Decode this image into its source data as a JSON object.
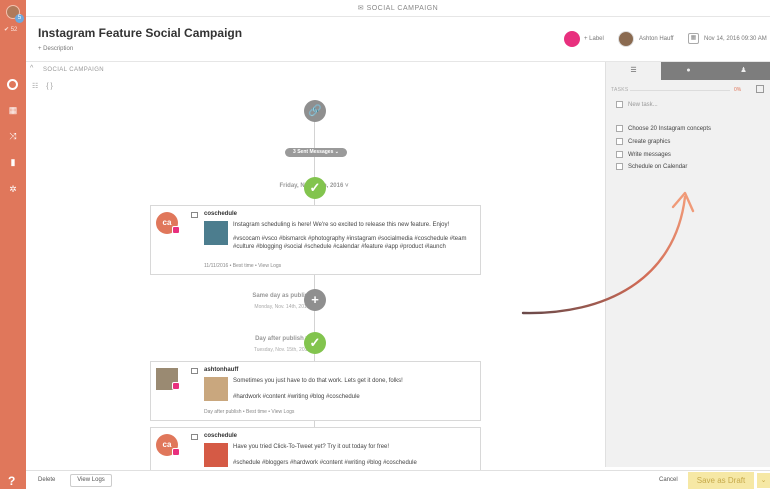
{
  "rail": {
    "badge": "5",
    "score": "✔ 52",
    "help": "?"
  },
  "topbar": {
    "label": "SOCIAL CAMPAIGN",
    "icon": "megaphone-icon"
  },
  "header": {
    "title": "Instagram Feature Social Campaign",
    "description": "+ Description",
    "label_action": "+ Label",
    "label_color": "#e8307e",
    "user_name": "Ashton Hauff",
    "datetime": "Nov 14, 2016 09:30 AM"
  },
  "subbar": {
    "label": "SOCIAL CAMPAIGN",
    "tool_grid": "☷",
    "tool_code": "{ }"
  },
  "timeline": {
    "sent_messages": "3 Sent Messages ⌄",
    "groups": [
      {
        "label": "Friday, Nov. 11th, 2016 ˅",
        "sub": ""
      },
      {
        "label": "Same day as publish",
        "sub": "Monday, Nov. 14th, 2016"
      },
      {
        "label": "Day after publish ˅",
        "sub": "Tuesday, Nov. 15th, 2016"
      }
    ],
    "cards": [
      {
        "account": "coschedule",
        "text1": "Instagram scheduling is here! We're so excited to release this new feature. Enjoy!",
        "text2": "#vscocam #vsco #bismarck #photography #instagram #socialmedia #coschedule #team #culture #blogging #social #schedule #calendar #feature #app #product #launch",
        "meta": "11/11/2016 • Best time • View Logs"
      },
      {
        "account": "ashtonhauff",
        "text1": "Sometimes you just have to do that work. Lets get it done, folks!",
        "text2": "#hardwork #content #writing #blog #coschedule",
        "meta": "Day after publish • Best time • View Logs"
      },
      {
        "account": "coschedule",
        "text1": "Have you tried Click-To-Tweet yet? Try it out today for free!",
        "text2": "#schedule #bloggers #hardwork #content #writing #blog #coschedule",
        "meta": ""
      }
    ]
  },
  "panel": {
    "tasks_title": "TASKS",
    "progress_percent": "0%",
    "progress_value": 0,
    "new_task_placeholder": "New task...",
    "tasks": [
      "Choose 20 Instagram concepts",
      "Create graphics",
      "Write messages",
      "Schedule on Calendar"
    ]
  },
  "bottom": {
    "delete": "Delete",
    "view_logs": "View Logs",
    "cancel": "Cancel",
    "save": "Save as Draft",
    "save_dropdown": "⌄"
  },
  "colors": {
    "rail": "#e0775b",
    "accent_green": "#82c44e",
    "label_pink": "#e8307e",
    "save_bg": "#f6e8a5"
  }
}
